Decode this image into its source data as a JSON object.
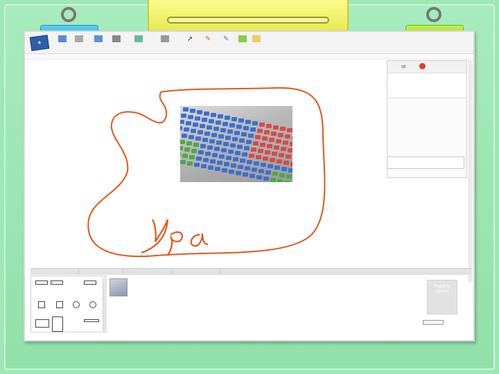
{
  "colors": {
    "frame_green": "#9fe8b5",
    "clip_blue": "#22a9e0",
    "clip_green": "#8ed320",
    "clip_yellow": "#e6e64a",
    "ink_orange": "#e8541a"
  },
  "handwriting": {
    "text": "Ура"
  },
  "bottom_panel": {
    "ready_text": "Ready to upload"
  },
  "icons": [
    "logo-icon",
    "pencil-icon",
    "select-arrow-icon",
    "mail-icon",
    "stop-icon"
  ]
}
